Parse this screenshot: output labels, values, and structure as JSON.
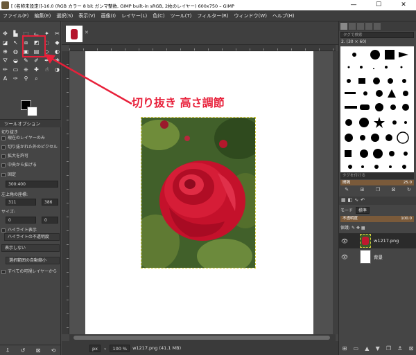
{
  "window": {
    "title": "[ (名称未設定)]-16.0 (RGB カラー 8 bit ガンマ整数, GIMP built-in sRGB, 2枚のレイヤー) 600x750 – GIMP",
    "minimize": "—",
    "maximize": "☐",
    "close": "✕"
  },
  "menu": [
    "ファイル(F)",
    "編集(E)",
    "選択(S)",
    "表示(V)",
    "画像(I)",
    "レイヤー(L)",
    "色(C)",
    "ツール(T)",
    "フィルター(R)",
    "ウィンドウ(W)",
    "ヘルプ(H)"
  ],
  "tool_options": {
    "tab_label": "ツールオプション",
    "section": "切り抜き",
    "current_layer_only": "現在のレイヤーのみ",
    "delete_cropped": "切り抜かれた外のピクセル",
    "allow_growing": "拡大を許可",
    "expand_from_center": "中央から拡げる",
    "fixed_label": "固定",
    "aspect_value": "300:400",
    "position_label": "左上角の座標:",
    "position_x": "311",
    "position_y": "386",
    "size_label": "サイズ:",
    "size_w": "0",
    "size_h": "0",
    "highlight": "ハイライト表示",
    "highlight_opacity": "ハイライトの不透明度",
    "guides": "表示しない",
    "auto_shrink": "選択範囲の自動縮小",
    "shrink_merged": "すべての可視レイヤーから"
  },
  "annotation": {
    "label": "切り抜き 高さ調節",
    "color": "#e8203a"
  },
  "statusbar": {
    "unit": "px",
    "zoom": "100 %",
    "info": "w1217.png (41.1 MB)"
  },
  "brushes": {
    "search_placeholder": "タグで検索",
    "name": "2. (30 × 60)",
    "tag_placeholder": "タグを付ける",
    "spacing_label": "間隔",
    "spacing_value": "25.0"
  },
  "layers": {
    "mode_label": "モード",
    "mode_value": "標準",
    "opacity_label": "不透明度",
    "opacity_value": "100.0",
    "lock_label": "保護:",
    "items": [
      {
        "name": "w1217.png"
      },
      {
        "name": "背景"
      }
    ]
  },
  "image_tab": {
    "close": "✕"
  }
}
